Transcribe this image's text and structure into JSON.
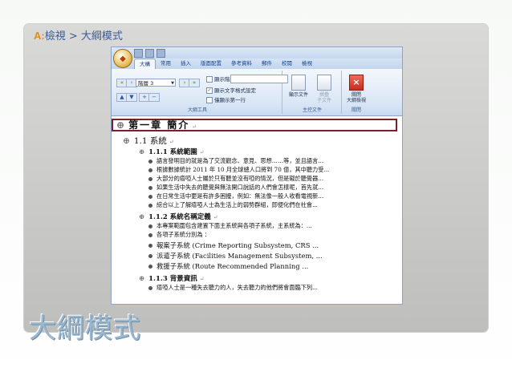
{
  "slide": {
    "breadcrumb_prefix": "A:",
    "breadcrumb": "檢視 > 大綱模式",
    "title": "大綱模式"
  },
  "window": {
    "office_button_icon": "office-logo-icon",
    "tabs": [
      "大構",
      "常用",
      "插入",
      "版面配置",
      "參考資料",
      "郵件",
      "校閱",
      "檢視"
    ],
    "active_tab": 0,
    "outline_tools": {
      "level_value": "階層 3",
      "show_level_label": "顯示階層:",
      "show_text_format_label": "顯示文字格式設定",
      "show_first_line_label": "僅顯示第一行",
      "group_label": "大綱工具"
    },
    "master_document": {
      "show_document_label": "顯示文件",
      "collapse_label": "摺疊",
      "subdocument_label": "子文件",
      "group_label": "主控文件"
    },
    "close": {
      "close_label": "關閉",
      "outline_view_label": "大綱檢視",
      "group_label": "關閉"
    }
  },
  "document": {
    "chapter": "第一章 簡介",
    "section": "1.1 系統",
    "subsections": [
      {
        "heading": "1.1.1 系統範圍",
        "lines": [
          "語言發明目的就是為了交流觀念、意見、思想……等，並且語言...",
          "根據數據統計 2011 年 10 月全球總人口將到 70 億，其中聽力受...",
          "大部分的瘖啞人士屬於只有聽並沒有啞的情況，但是礙於聽覺器...",
          "如果生活中失去的聽覺與無法開口說話的人們會怎樣呢，首先就...",
          "在日常生活中更是有許多困擾，例如：無法像一般人收看電視新...",
          "綜合以上了解瘖啞人士為生活上的弱勢群組，即便化們在社會..."
        ]
      },
      {
        "heading": "1.1.2 系統名稱定義",
        "lines": [
          "本專案範圍包含建置下面主系統與各項子系統，主系統為：...",
          "各項子系統分別為 ：",
          "報案子系統  (Crime Reporting Subsystem, CRS ...",
          "派遣子系統   (Facilities Management Subsystem, ...",
          "救援子系統 (Route Recommended Planning ..."
        ]
      },
      {
        "heading": "1.1.3 背景資訊",
        "lines": [
          "瘖啞人士是一種失去聽力的人，失去聽力的他們將會面臨下列..."
        ]
      }
    ]
  }
}
